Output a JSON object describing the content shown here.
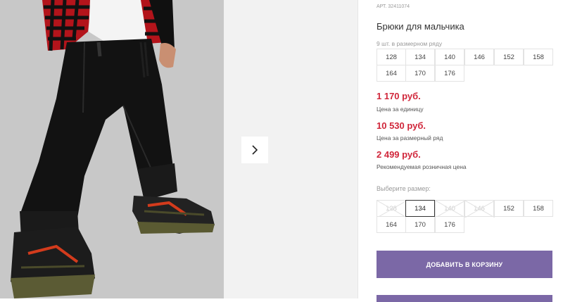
{
  "gallery": {
    "next_arrow_icon": "chevron-right-icon"
  },
  "product": {
    "article": "АРТ. 32411074",
    "title": "Брюки для мальчика",
    "set_label": "9 шт. в размерном ряду",
    "set_sizes": [
      "128",
      "134",
      "140",
      "146",
      "152",
      "158",
      "164",
      "170",
      "176"
    ],
    "prices": [
      {
        "value": "1 170 руб.",
        "label": "Цена за единицу"
      },
      {
        "value": "10 530 руб.",
        "label": "Цена за размерный ряд"
      },
      {
        "value": "2 499 руб.",
        "label": "Рекомендуемая розничная цена"
      }
    ],
    "price_color": "#d0263a",
    "choose_label": "Выберите размер:",
    "choose_sizes": [
      {
        "size": "128",
        "available": false
      },
      {
        "size": "134",
        "available": true,
        "selected": true
      },
      {
        "size": "140",
        "available": false
      },
      {
        "size": "146",
        "available": false
      },
      {
        "size": "152",
        "available": true
      },
      {
        "size": "158",
        "available": true
      },
      {
        "size": "164",
        "available": true
      },
      {
        "size": "170",
        "available": true
      },
      {
        "size": "176",
        "available": true
      }
    ],
    "add_to_cart_label": "ДОБАВИТЬ В КОРЗИНУ",
    "accent_color": "#7b68a6"
  }
}
